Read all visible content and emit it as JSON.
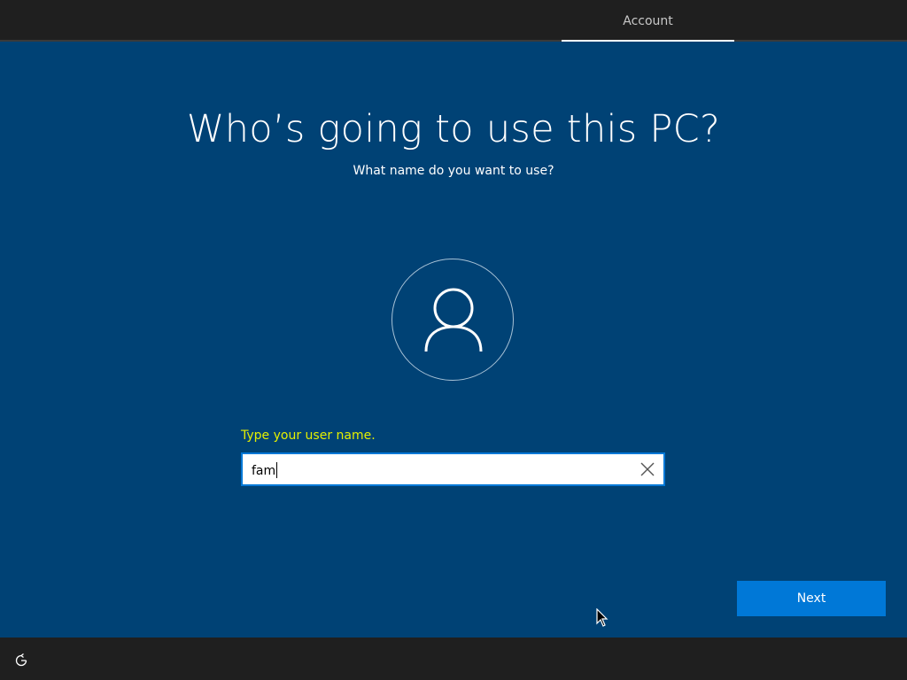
{
  "header": {
    "tabs": [
      {
        "label": "Account",
        "active": true
      }
    ]
  },
  "main": {
    "title": "Who’s going to use this PC?",
    "subtitle": "What name do you want to use?",
    "avatar_icon": "user-icon",
    "username_field": {
      "label": "Type your user name.",
      "value": "fam",
      "clear_icon": "close-icon"
    },
    "next_label": "Next"
  },
  "footer": {
    "ease_of_access_icon": "ease-of-access-icon"
  },
  "colors": {
    "background": "#004275",
    "bar": "#1f1f1f",
    "accent": "#0078d7",
    "label_highlight": "#e5f000"
  }
}
